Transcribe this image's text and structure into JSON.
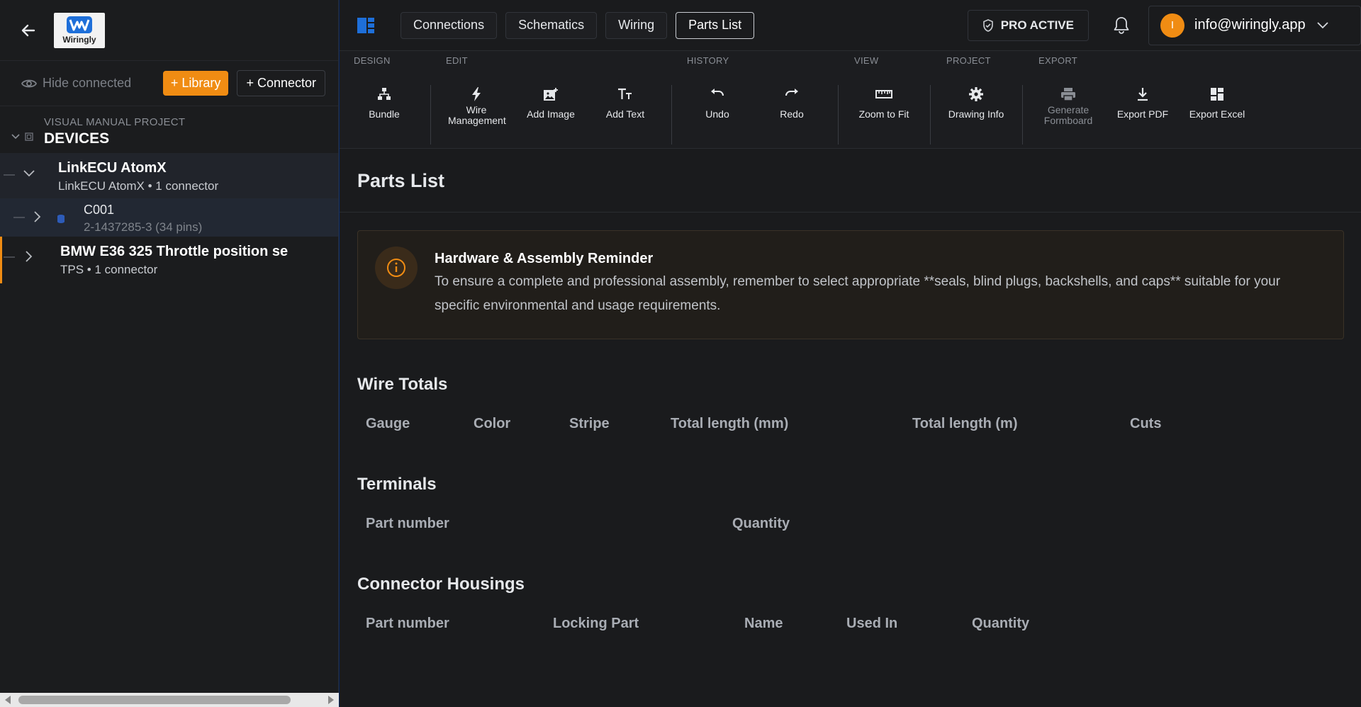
{
  "sidebar": {
    "logo_text": "Wiringly",
    "hide_connected": "Hide connected",
    "library_button": "+ Library",
    "connector_button": "+ Connector",
    "project_label": "VISUAL MANUAL PROJECT",
    "project_title": "DEVICES",
    "devices": [
      {
        "name": "LinkECU AtomX",
        "sub": "LinkECU AtomX • 1 connector",
        "connectors": [
          {
            "name": "C001",
            "sub": "2-1437285-3 (34 pins)"
          }
        ]
      },
      {
        "name": "BMW E36 325 Throttle position se",
        "sub": "TPS • 1 connector"
      }
    ],
    "dash": "—"
  },
  "topbar": {
    "tabs": [
      "Connections",
      "Schematics",
      "Wiring",
      "Parts List"
    ],
    "active_tab": "Parts List",
    "pro_badge": "PRO ACTIVE",
    "avatar_initial": "I",
    "email": "info@wiringly.app"
  },
  "ribbon": {
    "groups": {
      "design": "DESIGN",
      "edit": "EDIT",
      "history": "HISTORY",
      "view": "VIEW",
      "project": "PROJECT",
      "export": "EXPORT"
    },
    "buttons": {
      "bundle": "Bundle",
      "wire_management": "Wire Management",
      "add_image": "Add Image",
      "add_text": "Add Text",
      "undo": "Undo",
      "redo": "Redo",
      "zoom_to_fit": "Zoom to Fit",
      "drawing_info": "Drawing Info",
      "generate_formboard": "Generate Formboard",
      "export_pdf": "Export PDF",
      "export_excel": "Export Excel"
    }
  },
  "main": {
    "page_title": "Parts List",
    "reminder": {
      "title": "Hardware & Assembly Reminder",
      "text": "To ensure a complete and professional assembly, remember to select appropriate **seals, blind plugs, backshells, and caps** suitable for your specific environmental and usage requirements."
    },
    "wire_totals": {
      "title": "Wire Totals",
      "columns": [
        "Gauge",
        "Color",
        "Stripe",
        "Total length (mm)",
        "Total length (m)",
        "Cuts"
      ]
    },
    "terminals": {
      "title": "Terminals",
      "columns": [
        "Part number",
        "Quantity"
      ]
    },
    "connector_housings": {
      "title": "Connector Housings",
      "columns": [
        "Part number",
        "Locking Part",
        "Name",
        "Used In",
        "Quantity"
      ]
    }
  },
  "colors": {
    "accent": "#f08c13",
    "brand_blue": "#1e6fd9",
    "bg": "#1a1b1d"
  }
}
